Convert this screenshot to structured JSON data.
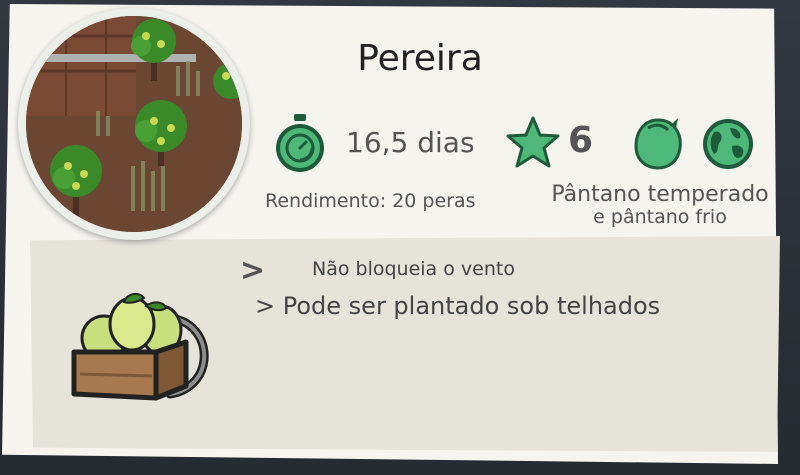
{
  "plant": {
    "name": "Pereira"
  },
  "stats": {
    "duration": "16,5 dias",
    "star_value": "6",
    "yield": "Rendimento: 20 peras",
    "biome_line1": "Pântano temperado",
    "biome_line2": "e pântano frio"
  },
  "traits": {
    "arrow_symbol": ">",
    "line1": "Não bloqueia o vento",
    "line2": "> Pode ser plantado sob telhados"
  },
  "icons": {
    "timer": "stopwatch-icon",
    "star": "star-icon",
    "swamp": "swamp-icon",
    "globe": "globe-icon",
    "crate": "pear-crate-icon",
    "portrait": "pear-tree-portrait"
  },
  "colors": {
    "accent_green": "#4db878",
    "accent_green_dark": "#1e5a3c",
    "card_bg": "#f5f4ef",
    "card_lower_bg": "#e6e3db"
  }
}
